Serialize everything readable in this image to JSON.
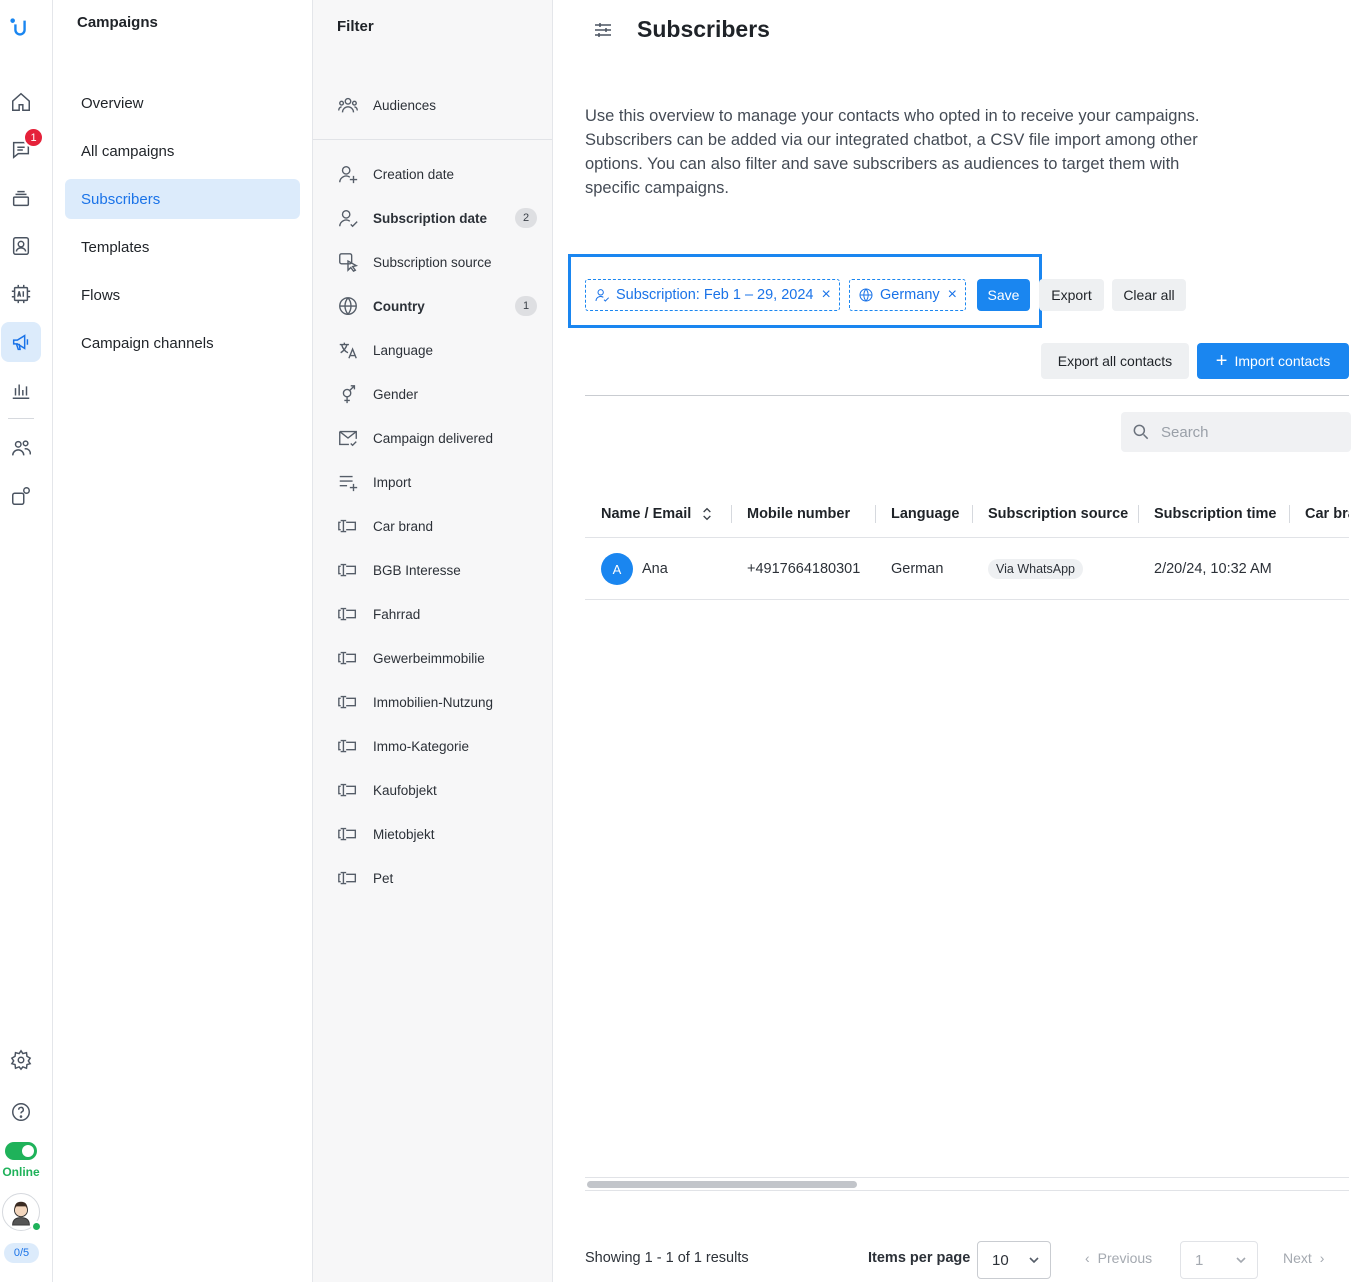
{
  "app": {
    "logo_icon": "userlike-logo",
    "accent_color": "#1a86f0"
  },
  "rail": {
    "badge_count": "1",
    "status_label": "Online",
    "quota": "0/5",
    "icons": [
      "home-icon",
      "chat-icon",
      "inbox-stack-icon",
      "contacts-icon",
      "ai-chip-icon",
      "megaphone-icon",
      "analytics-icon",
      "team-icon",
      "integrations-icon",
      "settings-icon",
      "help-icon"
    ]
  },
  "campaign_nav": {
    "title": "Campaigns",
    "items": [
      "Overview",
      "All campaigns",
      "Subscribers",
      "Templates",
      "Flows",
      "Campaign channels"
    ],
    "active_item": "Subscribers"
  },
  "filter_panel": {
    "title": "Filter",
    "audiences_label": "Audiences",
    "items": [
      {
        "label": "Creation date",
        "icon": "person-plus-icon",
        "count": ""
      },
      {
        "label": "Subscription date",
        "icon": "person-check-icon",
        "count": "2"
      },
      {
        "label": "Subscription source",
        "icon": "source-icon",
        "count": ""
      },
      {
        "label": "Country",
        "icon": "globe-icon",
        "count": "1"
      },
      {
        "label": "Language",
        "icon": "translate-icon",
        "count": ""
      },
      {
        "label": "Gender",
        "icon": "gender-icon",
        "count": ""
      },
      {
        "label": "Campaign delivered",
        "icon": "mail-check-icon",
        "count": ""
      },
      {
        "label": "Import",
        "icon": "list-add-icon",
        "count": ""
      },
      {
        "label": "Car brand",
        "icon": "custom-field-icon",
        "count": ""
      },
      {
        "label": "BGB Interesse",
        "icon": "custom-field-icon",
        "count": ""
      },
      {
        "label": "Fahrrad",
        "icon": "custom-field-icon",
        "count": ""
      },
      {
        "label": "Gewerbeimmobilie",
        "icon": "custom-field-icon",
        "count": ""
      },
      {
        "label": "Immobilien-Nutzung",
        "icon": "custom-field-icon",
        "count": ""
      },
      {
        "label": "Immo-Kategorie",
        "icon": "custom-field-icon",
        "count": ""
      },
      {
        "label": "Kaufobjekt",
        "icon": "custom-field-icon",
        "count": ""
      },
      {
        "label": "Mietobjekt",
        "icon": "custom-field-icon",
        "count": ""
      },
      {
        "label": "Pet",
        "icon": "custom-field-icon",
        "count": ""
      }
    ]
  },
  "main": {
    "title": "Subscribers",
    "intro": "Use this overview to manage your contacts who opted in to receive your campaigns. Subscribers can be added via our integrated chatbot, a CSV file import among other options. You can also filter and save subscribers as audiences to target them with specific campaigns.",
    "chips": {
      "subscription": "Subscription: Feb 1 – 29, 2024",
      "country": "Germany"
    },
    "buttons": {
      "save": "Save",
      "export": "Export",
      "clear_all": "Clear all",
      "export_all": "Export all contacts",
      "import": "Import contacts"
    },
    "search_placeholder": "Search",
    "table": {
      "headers": [
        "Name / Email",
        "Mobile number",
        "Language",
        "Subscription source",
        "Subscription time",
        "Car bra"
      ],
      "rows": [
        {
          "initial": "A",
          "name": "Ana",
          "mobile": "+4917664180301",
          "language": "German",
          "source": "Via WhatsApp",
          "time": "2/20/24, 10:32 AM"
        }
      ]
    },
    "footer": {
      "showing": "Showing 1 - 1 of 1 results",
      "items_per_page_label": "Items per page",
      "items_per_page": "10",
      "previous": "Previous",
      "page": "1",
      "next": "Next"
    }
  }
}
